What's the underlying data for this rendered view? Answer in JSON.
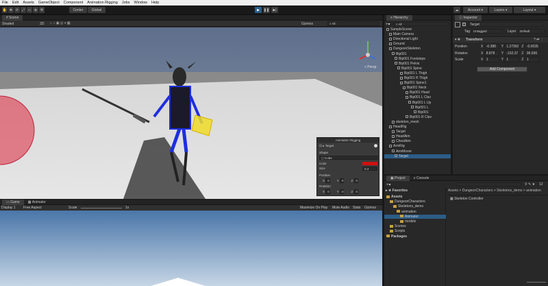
{
  "menu": [
    "File",
    "Edit",
    "Assets",
    "GameObject",
    "Component",
    "Animation Rigging",
    "Jobs",
    "Window",
    "Help"
  ],
  "toolbar": {
    "center": "Center",
    "global": "Global",
    "account": "Account",
    "layers": "Layers",
    "layout": "Layout"
  },
  "scene": {
    "tab": "Scene",
    "shading": "Shaded",
    "mode2d": "2D",
    "gizmos": "Gizmos",
    "search": "All",
    "persp": "< Persp"
  },
  "game": {
    "tab_game": "Game",
    "tab_animator": "Animator",
    "display": "Display 1",
    "aspect": "Free Aspect",
    "scale_label": "Scale",
    "scale_value": "1x",
    "maximize": "Maximize On Play",
    "mute": "Mute Audio",
    "stats": "Stats",
    "gizmos": "Gizmos"
  },
  "overlay": {
    "title": "Animation Rigging",
    "target": "Target",
    "shape_label": "Shape",
    "shape_value": "Cube",
    "color_label": "Color",
    "size_label": "Size",
    "size_value": "0.3",
    "position_label": "Position",
    "rotation_label": "Rotation",
    "px": "0",
    "py": "0",
    "pz": "0",
    "rx": "0",
    "ry": "0",
    "rz": "0",
    "color": "#d01010"
  },
  "hierarchy": {
    "tab": "Hierarchy",
    "search": "All",
    "items": [
      {
        "label": "SampleScene",
        "indent": 0,
        "icon": "scene"
      },
      {
        "label": "Main Camera",
        "indent": 1
      },
      {
        "label": "Directional Light",
        "indent": 1
      },
      {
        "label": "Ground",
        "indent": 1
      },
      {
        "label": "DungeonSkeleton",
        "indent": 1
      },
      {
        "label": "Bip001",
        "indent": 2
      },
      {
        "label": "Bip001 Footsteps",
        "indent": 3
      },
      {
        "label": "Bip001 Pelvis",
        "indent": 3
      },
      {
        "label": "Bip001 Spine",
        "indent": 4
      },
      {
        "label": "Bip001 L Thigh",
        "indent": 5
      },
      {
        "label": "Bip001 R Thigh",
        "indent": 5
      },
      {
        "label": "Bip001 Spine1",
        "indent": 5
      },
      {
        "label": "Bip001 Neck",
        "indent": 6
      },
      {
        "label": "Bip001 Head",
        "indent": 7
      },
      {
        "label": "Bip001 L Clav",
        "indent": 7
      },
      {
        "label": "Bip001 L Up",
        "indent": 8
      },
      {
        "label": "Bip001 L",
        "indent": 9
      },
      {
        "label": "Bip001",
        "indent": 10
      },
      {
        "label": "Bip001 R Clav",
        "indent": 7
      },
      {
        "label": "skeleton_mesh",
        "indent": 2
      },
      {
        "label": "HeadRig",
        "indent": 1
      },
      {
        "label": "Target",
        "indent": 2
      },
      {
        "label": "HeadAim",
        "indent": 2
      },
      {
        "label": "ChestAim",
        "indent": 2
      },
      {
        "label": "ArmRig",
        "indent": 1
      },
      {
        "label": "ArmMover",
        "indent": 2
      },
      {
        "label": "Target",
        "indent": 3,
        "selected": true
      }
    ]
  },
  "inspector": {
    "tab": "Inspector",
    "name": "Target",
    "tag_label": "Tag",
    "tag_value": "Untagged",
    "layer_label": "Layer",
    "layer_value": "Default",
    "transform": "Transform",
    "position_label": "Position",
    "rotation_label": "Rotation",
    "scale_label": "Scale",
    "pos": [
      "-0.388",
      "1.27992",
      "-0.0035"
    ],
    "rot": [
      "8.878",
      "-152.37",
      "96.596"
    ],
    "scl": [
      "1",
      "1",
      "1"
    ],
    "add_component": "Add Component"
  },
  "project": {
    "tab_project": "Project",
    "tab_console": "Console",
    "count": "12",
    "favorites": "Favorites",
    "breadcrumb": "Assets > DungeonCharacters > Skeletons_demo > animation",
    "file": "Skeleton Controller",
    "tree": [
      {
        "label": "Assets",
        "indent": 0,
        "bold": true
      },
      {
        "label": "DungeonCharacters",
        "indent": 1
      },
      {
        "label": "Skeletons_demo",
        "indent": 2
      },
      {
        "label": "animation",
        "indent": 3
      },
      {
        "label": "Animator",
        "indent": 4,
        "selected": true
      },
      {
        "label": "models",
        "indent": 4
      },
      {
        "label": "Scenes",
        "indent": 1
      },
      {
        "label": "Scripts",
        "indent": 1
      },
      {
        "label": "Packages",
        "indent": 0,
        "bold": true
      }
    ]
  }
}
